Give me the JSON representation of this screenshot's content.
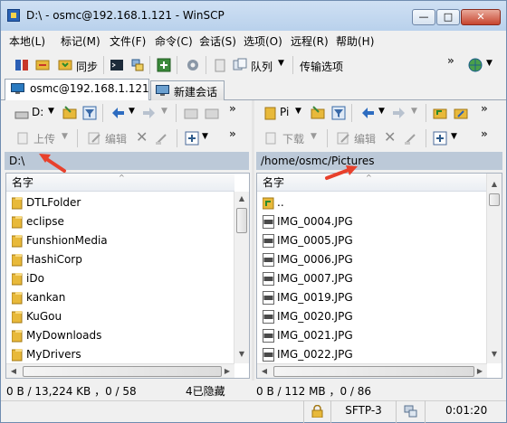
{
  "window": {
    "title": "D:\\ - osmc@192.168.1.121 - WinSCP",
    "min_label": "—",
    "max_label": "□",
    "close_label": "✕"
  },
  "menu": [
    "本地(L)",
    "标记(M)",
    "文件(F)",
    "命令(C)",
    "会话(S)",
    "选项(O)",
    "远程(R)",
    "帮助(H)"
  ],
  "toolbar": {
    "sync_label": "同步",
    "queue_label": "队列",
    "transfer_options_label": "传输选项"
  },
  "tabs": {
    "session": "osmc@192.168.1.121",
    "new_session": "新建会话"
  },
  "left": {
    "drive": "D:",
    "upload_label": "上传",
    "edit_label": "编辑",
    "path": "D:\\",
    "column": "名字",
    "items": [
      "DTLFolder",
      "eclipse",
      "FunshionMedia",
      "HashiCorp",
      "iDo",
      "kankan",
      "KuGou",
      "MyDownloads",
      "MyDrivers"
    ],
    "status_size": "0 B / 13,224 KB ，0 / 58",
    "status_hidden": "4已隐藏"
  },
  "right": {
    "drive": "Pi",
    "download_label": "下载",
    "edit_label": "编辑",
    "path": "/home/osmc/Pictures",
    "column": "名字",
    "parent": "..",
    "items": [
      "IMG_0004.JPG",
      "IMG_0005.JPG",
      "IMG_0006.JPG",
      "IMG_0007.JPG",
      "IMG_0019.JPG",
      "IMG_0020.JPG",
      "IMG_0021.JPG",
      "IMG_0022.JPG"
    ],
    "status_size": "0 B / 112 MB ，0 / 86"
  },
  "status": {
    "protocol": "SFTP-3",
    "elapsed": "0:01:20"
  },
  "colors": {
    "folder": "#e8b93a",
    "pathbar": "#bcc9d8",
    "annotation_arrow": "#e8412c",
    "title_bar": "#c4d8ef"
  },
  "icons": [
    "app-icon",
    "folder-icon",
    "jpg-file-icon",
    "parent-dir-icon",
    "lock-icon",
    "network-icon",
    "red-arrow-annotation"
  ]
}
